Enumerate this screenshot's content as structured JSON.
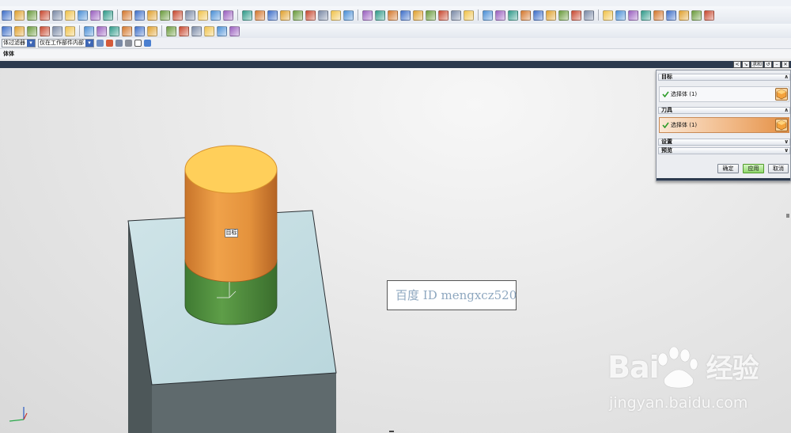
{
  "toolbar": {
    "row1_icons": [
      "layer-icon",
      "view-icon",
      "cube-icon",
      "sketch-icon",
      "extrude-icon",
      "revolve-icon",
      "line-icon",
      "arc-icon",
      "spline-icon",
      "point-icon",
      "blend-icon",
      "chamfer-icon",
      "shell-icon",
      "hole-icon",
      "boss-icon",
      "pocket-icon",
      "union-icon",
      "subtract-icon",
      "intersect-icon",
      "trim-icon",
      "mirror-icon",
      "pattern-icon",
      "measure-icon",
      "analysis-icon",
      "render-icon",
      "snap-icon",
      "datum-icon",
      "csys-icon",
      "edit-icon",
      "delete-icon",
      "move-icon",
      "copy-icon",
      "scale-icon",
      "offset-icon",
      "thicken-icon",
      "sew-icon",
      "patch-icon",
      "split-icon",
      "draft-icon",
      "rib-icon",
      "gear-icon",
      "spring-icon",
      "bolt-icon",
      "nut-icon",
      "washer-icon",
      "pin-icon",
      "bearing-icon",
      "shaft-icon",
      "assembly-icon",
      "constraint-icon",
      "explode-icon",
      "drawing-icon",
      "section-icon",
      "print-icon"
    ],
    "row2_icons": [
      "fillet-icon",
      "curve-icon",
      "arrow-icon",
      "face-icon",
      "edge-icon",
      "body-icon",
      "feature-icon",
      "sheet-icon",
      "wrap-icon",
      "emboss-icon",
      "flange-icon",
      "bend-icon",
      "unbend-icon",
      "cut-icon",
      "weld-icon",
      "tube-icon",
      "frame-icon",
      "pipe-icon"
    ],
    "filter_combo_value": "体过滤器",
    "scope_combo_value": "仅在工作部件内部",
    "body_label": "体体"
  },
  "dialog_controls": [
    "<",
    "↘",
    "求和",
    "↺",
    "–",
    "✕"
  ],
  "viewport": {
    "target_label": "目标",
    "watermark_text": "百度 ID mengxcz520",
    "baidu_logo_left": "Bai",
    "baidu_logo_right": "经验",
    "baidu_url": "jingyan.baidu.com"
  },
  "panel": {
    "target_section": "目标",
    "target_select": "选择体 (1)",
    "tool_section": "刀具",
    "tool_select": "选择体 (1)",
    "settings_section": "设置",
    "preview_section": "预览",
    "ok_label": "确定",
    "apply_label": "应用",
    "cancel_label": "取消"
  },
  "colors": {
    "cylinder_orange": "#e8943a",
    "cylinder_top": "#ffcf5a",
    "cylinder_green": "#5a9a45",
    "block_top": "#c4dde2",
    "block_side": "#5f6a6e",
    "titlebar": "#2c3a4e",
    "apply_green": "#8fd66c"
  }
}
